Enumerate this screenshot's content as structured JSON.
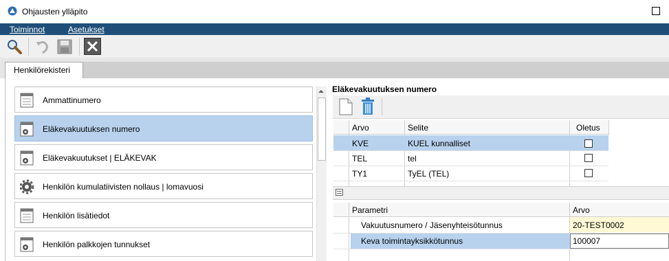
{
  "window": {
    "title": "Ohjausten ylläpito"
  },
  "menu": {
    "items": [
      {
        "label": "Toiminnot"
      },
      {
        "label": "Asetukset"
      }
    ]
  },
  "toolbar": {
    "buttons": [
      {
        "icon": "search-icon"
      },
      {
        "icon": "undo-icon"
      },
      {
        "icon": "save-icon"
      },
      {
        "icon": "close-icon"
      }
    ]
  },
  "tabs": [
    {
      "label": "Henkilörekisteri"
    }
  ],
  "left_list": [
    {
      "label": "Ammattinumero",
      "icon": "document-icon"
    },
    {
      "label": "Eläkevakuutuksen numero",
      "icon": "document-gear-icon",
      "selected": true
    },
    {
      "label": "Eläkevakuutukset | ELÄKEVAK",
      "icon": "document-gear-icon"
    },
    {
      "label": "Henkilön kumulatiivisten nollaus | lomavuosi",
      "icon": "gear-icon"
    },
    {
      "label": "Henkilön lisätiedot",
      "icon": "document-icon"
    },
    {
      "label": "Henkilön palkkojen tunnukset",
      "icon": "document-gear-icon"
    }
  ],
  "right": {
    "title": "Eläkevakuutuksen numero",
    "grid1": {
      "headers": {
        "arvo": "Arvo",
        "selite": "Selite",
        "oletus": "Oletus"
      },
      "rows": [
        {
          "arvo": "KVE",
          "selite": "KUEL kunnalliset",
          "oletus": false,
          "selected": true
        },
        {
          "arvo": "TEL",
          "selite": "tel",
          "oletus": false
        },
        {
          "arvo": "TY1",
          "selite": "TyEL (TEL)",
          "oletus": false
        }
      ]
    },
    "grid2": {
      "headers": {
        "parametri": "Parametri",
        "arvo": "Arvo"
      },
      "rows": [
        {
          "parametri": "Vakuutusnumero / Jäsenyhteisötunnus",
          "arvo": "20-TEST0002"
        },
        {
          "parametri": "Keva toimintayksikkötunnus",
          "arvo": "100007",
          "selected": true
        }
      ]
    }
  },
  "colors": {
    "menubar": "#1f4f79",
    "selection": "#b8d2ee",
    "highlight_cell": "#fff9d6"
  }
}
